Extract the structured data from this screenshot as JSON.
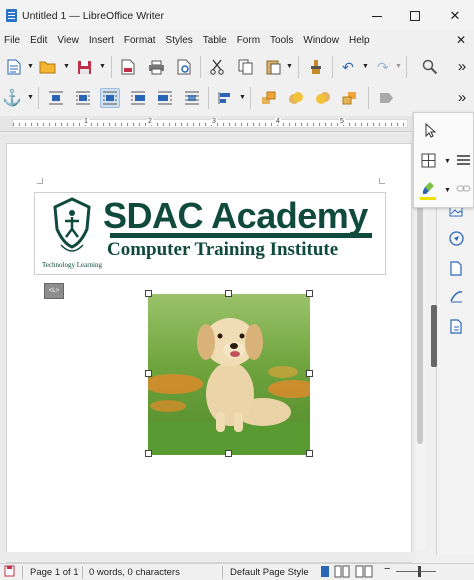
{
  "window": {
    "title": "Untitled 1 — LibreOffice Writer",
    "minimize_glyph": "",
    "maximize_glyph": "",
    "close_glyph": "✕"
  },
  "menubar": {
    "items": [
      "File",
      "Edit",
      "View",
      "Insert",
      "Format",
      "Styles",
      "Table",
      "Form",
      "Tools",
      "Window",
      "Help"
    ],
    "close_glyph": "✕"
  },
  "toolbar1": {
    "overflow_glyph": "»"
  },
  "toolbar2": {
    "overflow_glyph": "»"
  },
  "ruler": {
    "numbers": [
      "1",
      "2",
      "3",
      "4",
      "5"
    ]
  },
  "document": {
    "logo": {
      "title": "SDAC Academy",
      "subtitle": "Computer Training Institute",
      "emblem_text": "Technology Learning",
      "brand_color": "#0f4a3c"
    },
    "anchor_badge": "<L>"
  },
  "statusbar": {
    "page": "Page 1 of 1",
    "words": "0 words, 0 characters",
    "page_style": "Default Page Style"
  },
  "colors": {
    "accent": "#2a66b5",
    "selection": "#cfe0f3",
    "highlight": "#f0e000"
  }
}
